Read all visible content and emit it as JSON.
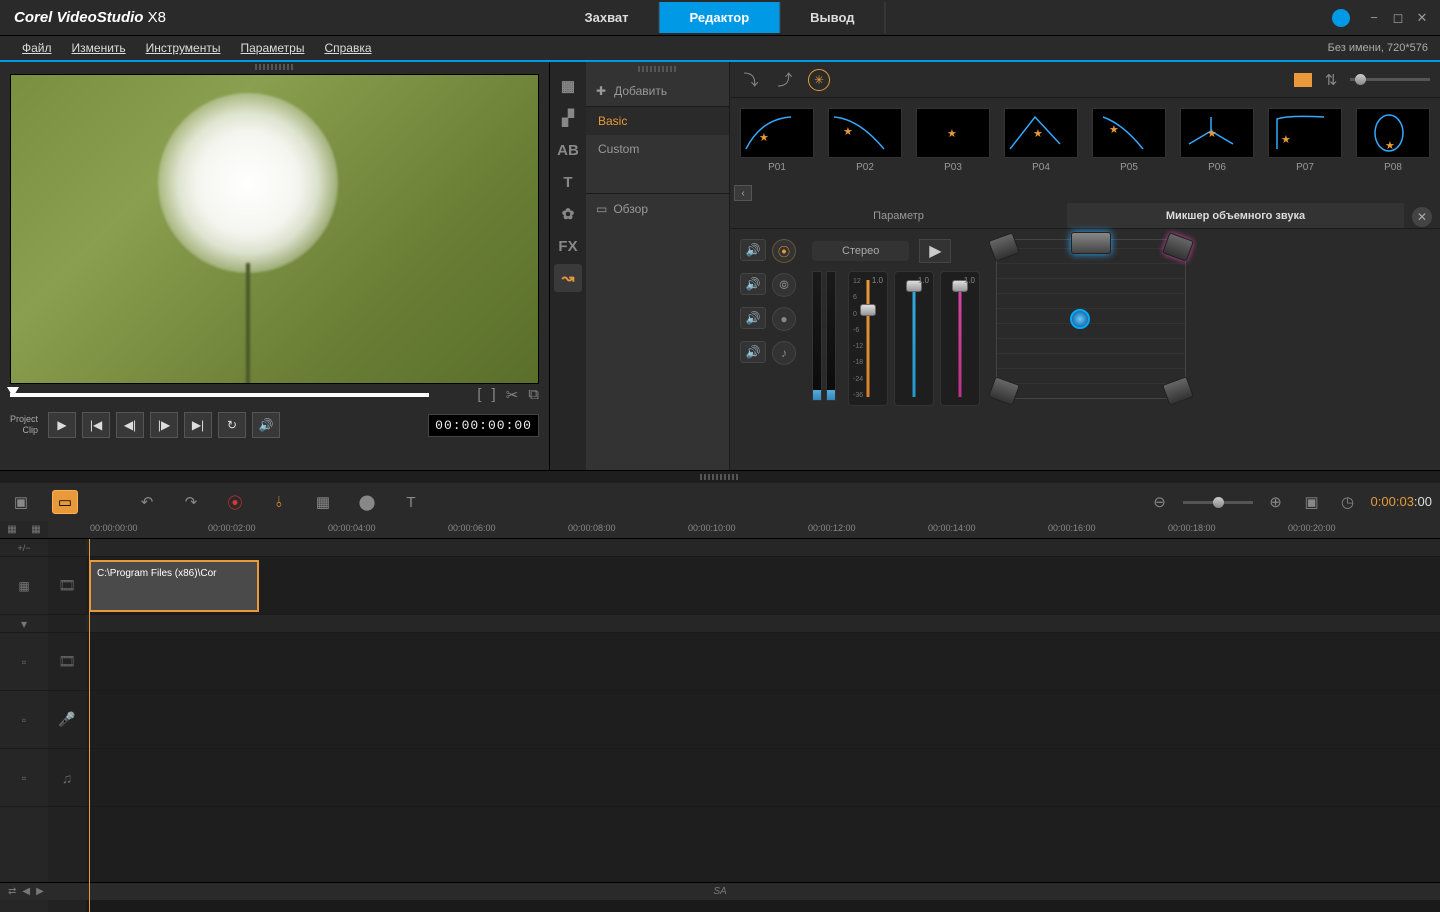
{
  "app": {
    "title_prefix": "Corel",
    "title_main": "VideoStudio",
    "title_suffix": "X8"
  },
  "modes": {
    "capture": "Захват",
    "editor": "Редактор",
    "output": "Вывод"
  },
  "menu": {
    "file": "Файл",
    "edit": "Изменить",
    "tools": "Инструменты",
    "settings": "Параметры",
    "help": "Справка"
  },
  "project_info": "Без имени, 720*576",
  "preview": {
    "project_label": "Project",
    "clip_label": "Clip",
    "timecode": "00:00:00:00"
  },
  "library": {
    "add": "Добавить",
    "categories": {
      "basic": "Basic",
      "custom": "Custom"
    },
    "overview": "Обзор",
    "presets": [
      "P01",
      "P02",
      "P03",
      "P04",
      "P05",
      "P06",
      "P07",
      "P08"
    ]
  },
  "panels": {
    "attribute": "Параметр",
    "mixer": "Микшер объемного звука",
    "stereo": "Стерео"
  },
  "fader_scale": [
    "12",
    "6",
    "0",
    "-6",
    "-12",
    "-18",
    "-24",
    "-36"
  ],
  "fader_readouts": {
    "a": "1.0",
    "b": "1.0",
    "c": "1.0"
  },
  "timeline": {
    "marks": [
      "00:00:00:00",
      "00:00:02:00",
      "00:00:04:00",
      "00:00:06:00",
      "00:00:08:00",
      "00:00:10:00",
      "00:00:12:00",
      "00:00:14:00",
      "00:00:16:00",
      "00:00:18:00",
      "00:00:20:00"
    ],
    "timecode_sec": "0:00:03",
    "timecode_frames": ":00",
    "clip_name": "C:\\Program Files (x86)\\Cor",
    "addremove": "+/−"
  },
  "statusbar": {
    "center": "SA"
  },
  "sidebar_labels": {
    "ab": "AB",
    "t": "T",
    "fx": "FX"
  }
}
